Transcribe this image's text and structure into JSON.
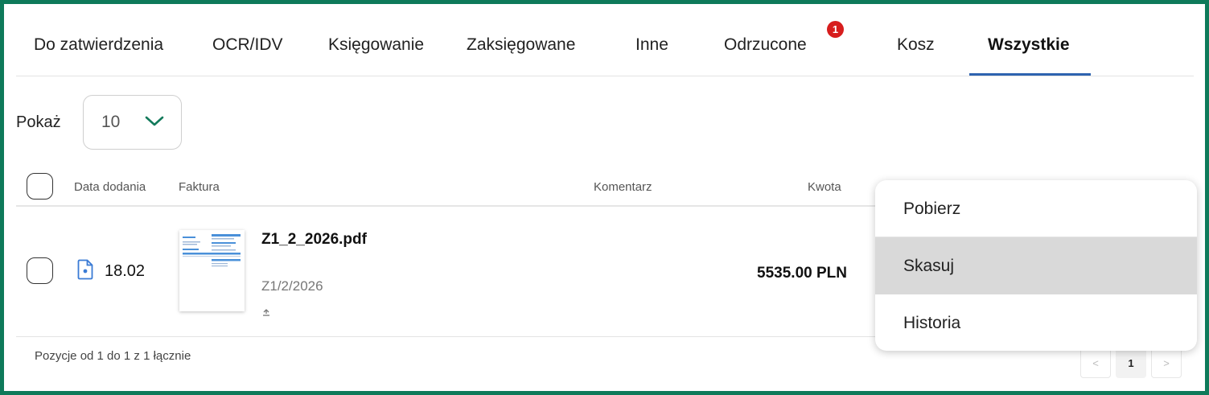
{
  "tabs": [
    {
      "label": "Do zatwierdzenia"
    },
    {
      "label": "OCR/IDV"
    },
    {
      "label": "Księgowanie"
    },
    {
      "label": "Zaksięgowane"
    },
    {
      "label": "Inne"
    },
    {
      "label": "Odrzucone",
      "badge": "1"
    },
    {
      "label": "Kosz"
    },
    {
      "label": "Wszystkie",
      "active": true
    }
  ],
  "show": {
    "label": "Pokaż",
    "value": "10"
  },
  "table": {
    "headers": {
      "date": "Data dodania",
      "invoice": "Faktura",
      "comment": "Komentarz",
      "amount": "Kwota"
    },
    "rows": [
      {
        "date": "18.02",
        "filename": "Z1_2_2026.pdf",
        "number": "Z1/2/2026",
        "comment": "",
        "amount": "5535.00 PLN"
      }
    ]
  },
  "footer": {
    "summary": "Pozycje od 1 do 1 z 1 łącznie",
    "current_page": "1",
    "prev": "<",
    "next": ">"
  },
  "context_menu": {
    "items": [
      "Pobierz",
      "Skasuj",
      "Historia"
    ],
    "hovered": "Skasuj"
  },
  "colors": {
    "frame": "#0f7a5a",
    "accent_tab": "#2e63b0",
    "badge": "#d71d1d",
    "chevron": "#127a5b",
    "file_icon": "#3a7bd5"
  }
}
